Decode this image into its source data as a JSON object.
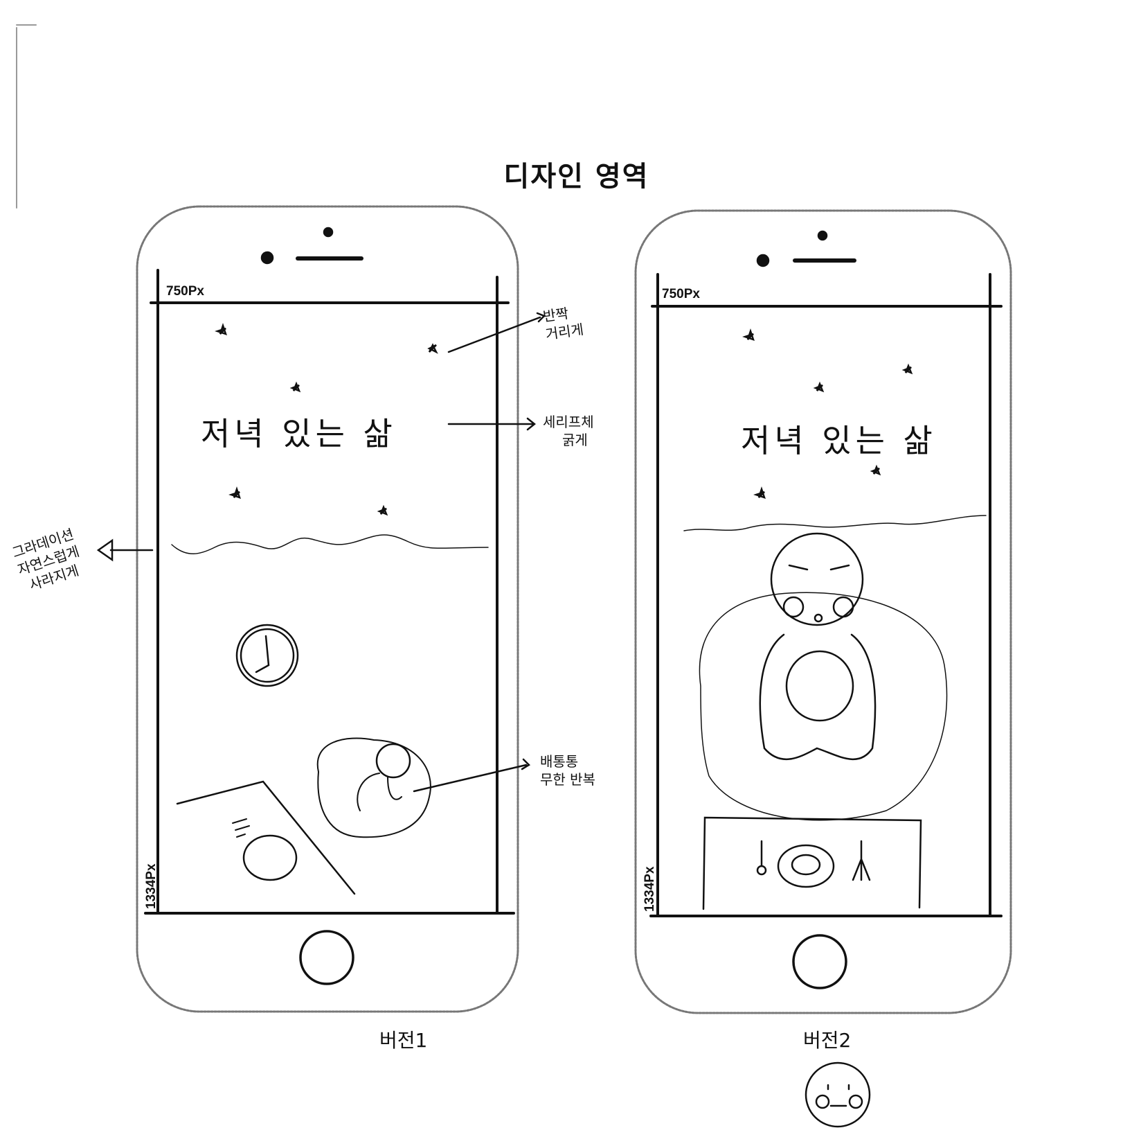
{
  "heading": "디자인 영역",
  "phones": [
    {
      "width_label": "750Px",
      "height_label": "1334Px",
      "headline": "저녁 있는 삶",
      "caption": "버전1"
    },
    {
      "width_label": "750Px",
      "height_label": "1334Px",
      "headline": "저녁 있는 삶",
      "caption": "버전2"
    }
  ],
  "annotations": {
    "sparkle": [
      "반짝",
      "거리게"
    ],
    "font": [
      "세리프체",
      "굵게"
    ],
    "gradient": [
      "그라데이션",
      "자연스럽게",
      "사라지게"
    ],
    "belly": [
      "배통통",
      "무한 반복"
    ]
  }
}
